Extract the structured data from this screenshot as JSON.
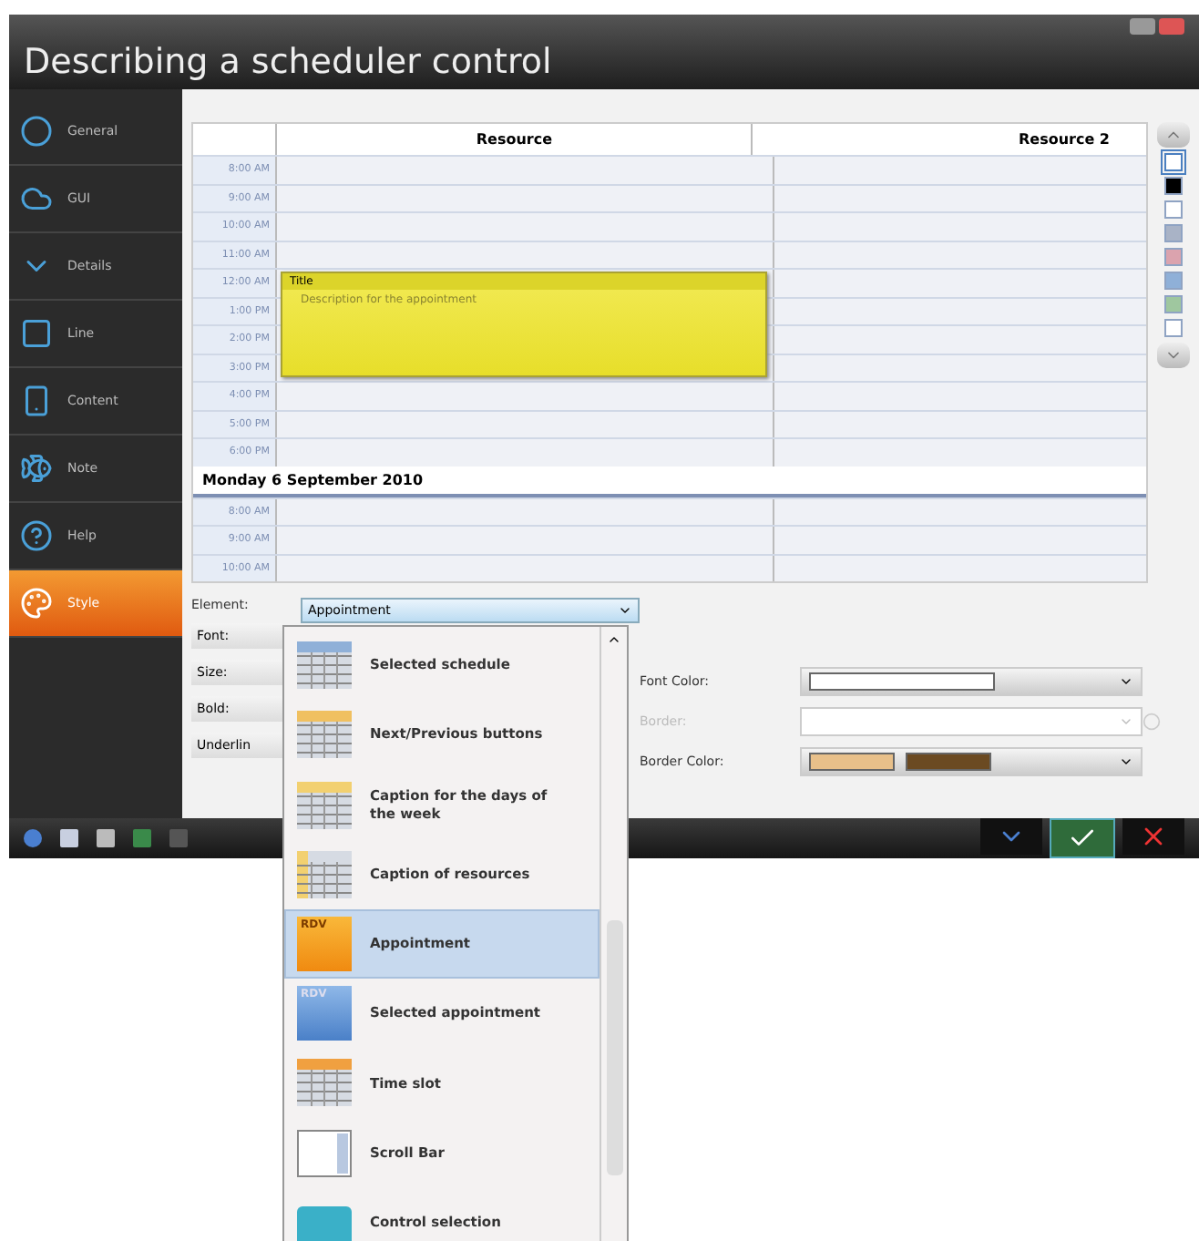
{
  "window": {
    "title": "Describing a scheduler control"
  },
  "sidebar": {
    "items": [
      {
        "label": "General",
        "selected": false
      },
      {
        "label": "GUI",
        "selected": false
      },
      {
        "label": "Details",
        "selected": false
      },
      {
        "label": "Line",
        "selected": false
      },
      {
        "label": "Content",
        "selected": false
      },
      {
        "label": "Note",
        "selected": false
      },
      {
        "label": "Help",
        "selected": false
      },
      {
        "label": "Style",
        "selected": true
      }
    ]
  },
  "schedule": {
    "columns": [
      "Resource",
      "Resource 2"
    ],
    "first_block": {
      "times": [
        {
          "time": "8:00 AM"
        },
        {
          "time": "9:00 AM"
        },
        {
          "time": "10:00 AM"
        },
        {
          "time": "11:00 AM"
        },
        {
          "time": "12:00 AM",
          "appointment": {
            "title": "Title",
            "description": "Description for the appointment"
          }
        },
        {
          "time": "1:00 PM"
        },
        {
          "time": "2:00 PM"
        },
        {
          "time": "3:00 PM"
        },
        {
          "time": "4:00 PM"
        },
        {
          "time": "5:00 PM"
        },
        {
          "time": "6:00 PM"
        }
      ]
    },
    "second_block": {
      "date": "Monday 6 September 2010",
      "times": [
        {
          "time": "8:00 AM"
        },
        {
          "time": "9:00 AM"
        },
        {
          "time": "10:00 AM"
        }
      ]
    }
  },
  "palette": {
    "swatches": [
      {
        "color": "#ffffff",
        "selected": true
      },
      {
        "color": "#000000",
        "selected": false
      },
      {
        "color": "#ffffff",
        "selected": false
      },
      {
        "color": "#a9b3c6",
        "selected": false
      },
      {
        "color": "#dba3ae",
        "selected": false
      },
      {
        "color": "#8fb0d8",
        "selected": false
      },
      {
        "color": "#9fc79f",
        "selected": false
      },
      {
        "color": "#ffffff",
        "selected": false
      }
    ]
  },
  "style_form": {
    "element": {
      "label": "Element:",
      "value": "Appointment"
    },
    "left_fields": [
      "Font:",
      "Size:",
      "Bold:",
      "Underlin"
    ],
    "font_color": {
      "label": "Font Color:",
      "swatches": [
        {
          "color": "#ffffff"
        }
      ]
    },
    "border": {
      "label": "Border:",
      "disabled": true
    },
    "border_color": {
      "label": "Border Color:",
      "swatches": [
        {
          "color": "#e8c08a"
        },
        {
          "color": "#6b4a22"
        }
      ]
    }
  },
  "dropdown": {
    "items": [
      {
        "kind": "schedule",
        "label": "Selected schedule",
        "selected": false
      },
      {
        "kind": "buttons",
        "label": "Next/Previous buttons",
        "selected": false
      },
      {
        "kind": "days",
        "label": "Caption for the days of the week",
        "selected": false
      },
      {
        "kind": "resources",
        "label": "Caption of resources",
        "selected": false
      },
      {
        "kind": "appointment",
        "label": "Appointment",
        "badge": "RDV",
        "selected": true
      },
      {
        "kind": "selected-appointment",
        "label": "Selected appointment",
        "badge": "RDV",
        "selected": false
      },
      {
        "kind": "slot",
        "label": "Time slot",
        "selected": false
      },
      {
        "kind": "scrollbar",
        "label": "Scroll Bar",
        "selected": false
      },
      {
        "kind": "control",
        "label": "Control selection",
        "selected": false
      }
    ]
  }
}
